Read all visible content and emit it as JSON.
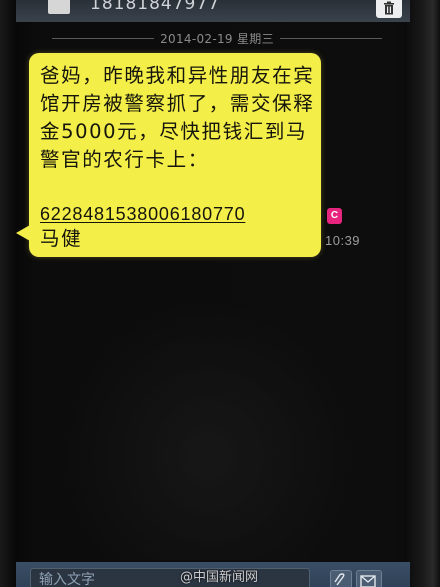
{
  "header": {
    "contact_number": "18181847977"
  },
  "thread": {
    "date_divider": "2014-02-19 星期三",
    "message": {
      "body": "爸妈，昨晚我和异性朋友在宾馆开房被警察抓了，需交保释金5000元，尽快把钱汇到马警官的农行卡上：",
      "bank_card_number": "6228481538006180770",
      "signature": "马健",
      "sim_badge": "C",
      "time": "10:39",
      "bubble_color": "#f4ee49"
    }
  },
  "composer": {
    "placeholder": "输入文字"
  },
  "watermark": {
    "text": "@中国新闻网"
  },
  "icons": {
    "delete": "trash-icon",
    "attach": "attach-icon",
    "send": "send-icon"
  }
}
